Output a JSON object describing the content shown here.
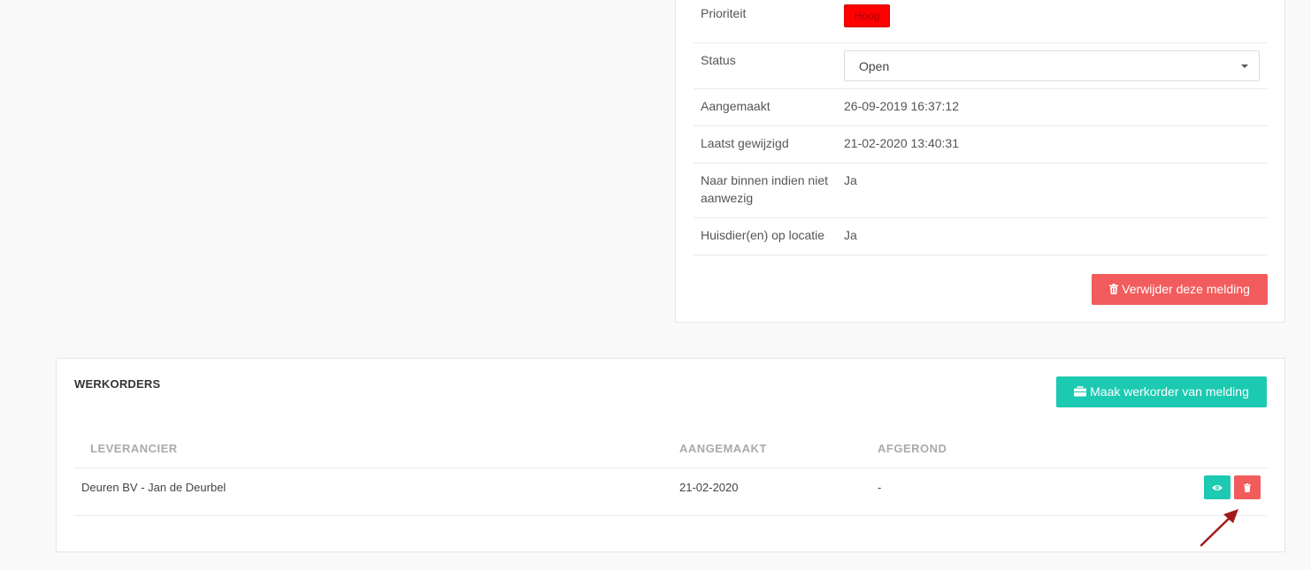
{
  "details": {
    "rows": [
      {
        "label": "Prioriteit",
        "value": "Hoog"
      },
      {
        "label": "Status",
        "value": "Open"
      },
      {
        "label": "Aangemaakt",
        "value": "26-09-2019 16:37:12"
      },
      {
        "label": "Laatst gewijzigd",
        "value": "21-02-2020 13:40:31"
      },
      {
        "label": "Naar binnen indien niet aanwezig",
        "value": "Ja"
      },
      {
        "label": "Huisdier(en) op locatie",
        "value": "Ja"
      }
    ],
    "priority_color": "#ff0000",
    "delete_button_label": "Verwijder deze melding",
    "delete_button_icon": "trash-icon"
  },
  "workorders": {
    "title": "WERKORDERS",
    "create_button_label": "Maak werkorder van melding",
    "create_button_icon": "briefcase-icon",
    "columns": [
      "LEVERANCIER",
      "AANGEMAAKT",
      "AFGEROND"
    ],
    "rows": [
      {
        "supplier": "Deuren BV - Jan de Deurbel",
        "created": "21-02-2020",
        "done": "-"
      }
    ],
    "row_actions": [
      "eye-icon",
      "trash-icon"
    ]
  },
  "colors": {
    "accent_teal": "#1cc9b1",
    "danger_red": "#f25c5c",
    "annotation_arrow": "#a31919"
  }
}
